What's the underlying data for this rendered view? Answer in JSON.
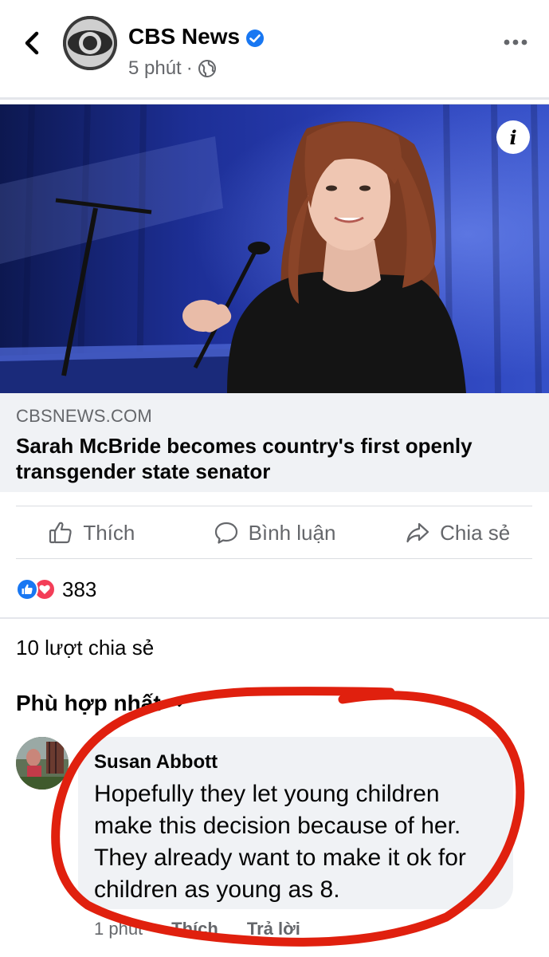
{
  "header": {
    "page_name": "CBS News",
    "time": "5 phút",
    "separator": "·",
    "icons": {
      "back": "chevron-left-icon",
      "verified": "verified-badge-icon",
      "privacy": "globe-icon",
      "more": "more-dots-icon"
    }
  },
  "link_card": {
    "domain": "CBSNEWS.COM",
    "title": "Sarah McBride becomes country's first openly transgender state senator",
    "info_label": "i"
  },
  "actions": {
    "like": "Thích",
    "comment": "Bình luận",
    "share": "Chia sẻ"
  },
  "reactions": {
    "count": "383",
    "types": [
      "like",
      "love"
    ]
  },
  "shares_text": "10 lượt chia sẻ",
  "sort_label": "Phù hợp nhất",
  "comment": {
    "author": "Susan Abbott",
    "text": "Hopefully they let young children make this decision because of her. They already want to make it ok for children as young as 8.",
    "time": "1 phút",
    "like": "Thích",
    "reply": "Trả lời"
  },
  "colors": {
    "accent_blue": "#1877f2",
    "love_red": "#f33e58",
    "secondary_text": "#65676b",
    "annotation_red": "#e0200e"
  }
}
